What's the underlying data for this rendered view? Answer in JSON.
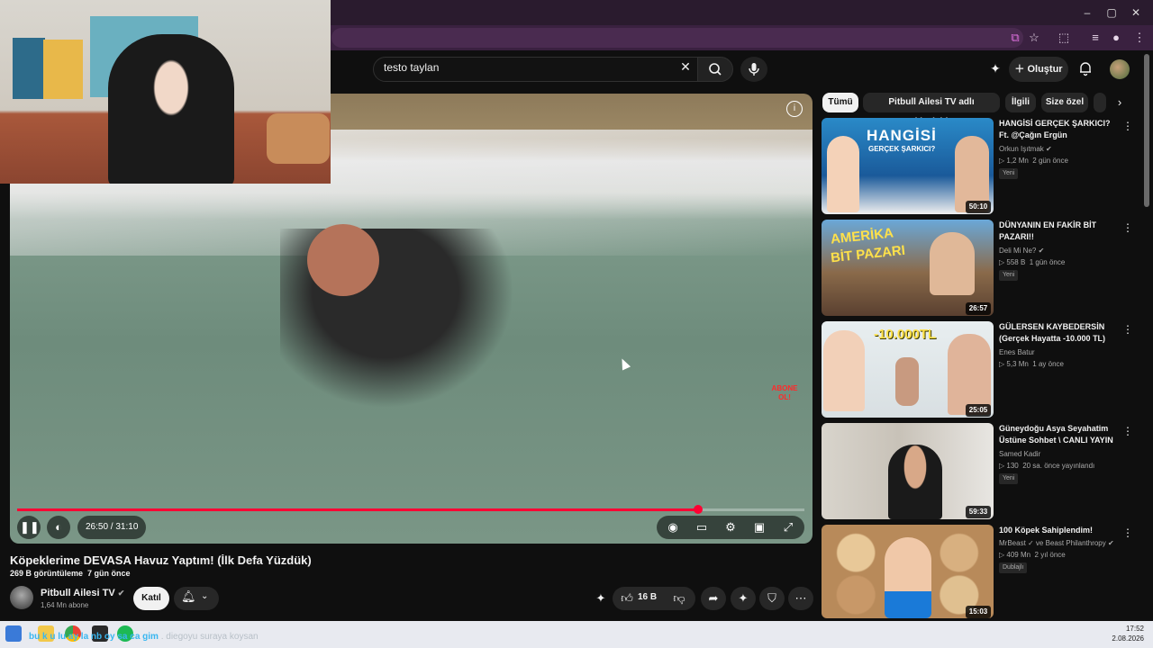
{
  "window": {
    "controls": [
      "–",
      "▢",
      "✕"
    ]
  },
  "search": {
    "query": "testo taylan"
  },
  "header": {
    "create_label": "Oluştur"
  },
  "player": {
    "current_time": "26:50",
    "duration": "31:10",
    "time_display": "26:50 / 31:10",
    "progress_fraction": 0.865,
    "watermark": "ABONE OL!"
  },
  "video": {
    "title": "Köpeklerime DEVASA Havuz Yaptım! (İlk Defa Yüzdük)",
    "views": "269 B görüntüleme",
    "age": "7 gün önce",
    "channel": "Pitbull Ailesi TV",
    "subscribers": "1,64 Mn abone",
    "join_label": "Katıl",
    "likes": "16 B"
  },
  "chips": [
    {
      "label": "Tümü",
      "active": true
    },
    {
      "label": "Pitbull Ailesi TV adlı yükleyiciden",
      "active": false
    },
    {
      "label": "İlgili",
      "active": false
    },
    {
      "label": "Size özel",
      "active": false
    }
  ],
  "recommendations": [
    {
      "title": "HANGİSİ GERÇEK ŞARKICI? Ft. @Çağın Ergün",
      "channel": "Orkun Işıtmak",
      "verified": true,
      "views": "1,2 Mn",
      "age": "2 gün önce",
      "badge": "Yeni",
      "duration": "50:10",
      "thumb_text": "HANGİSİ",
      "thumb_sub": "GERÇEK ŞARKICI?"
    },
    {
      "title": "DÜNYANIN EN FAKİR BİT PAZARI!!",
      "channel": "Deli Mi Ne?",
      "verified": true,
      "views": "558 B",
      "age": "1 gün önce",
      "badge": "Yeni",
      "duration": "26:57",
      "thumb_text": "AMERİKA",
      "thumb_sub": "BİT PAZARI"
    },
    {
      "title": "GÜLERSEN KAYBEDERSİN (Gerçek Hayatta -10.000 TL)",
      "channel": "Enes Batur",
      "verified": false,
      "views": "5,3 Mn",
      "age": "1 ay önce",
      "badge": "",
      "duration": "25:05",
      "thumb_text": "-10.000TL",
      "thumb_sub": ""
    },
    {
      "title": "Güneydoğu Asya Seyahatim Üstüne Sohbet \\ CANLI YAYIN",
      "channel": "Samed Kadir",
      "verified": false,
      "views": "130",
      "age": "20 sa. önce yayınlandı",
      "badge": "Yeni",
      "duration": "59:33",
      "thumb_text": "",
      "thumb_sub": ""
    },
    {
      "title": "100 Köpek Sahiplendim!",
      "channel": "MrBeast ✓ ve Beast Philanthropy",
      "verified": true,
      "views": "409 Mn",
      "age": "2 yıl önce",
      "badge": "Dublajlı",
      "duration": "15:03",
      "thumb_text": "",
      "thumb_sub": ""
    }
  ],
  "taskbar": {
    "ticker_primary": "bu k u lu ay la nb oy sa ca gim",
    "ticker_secondary": ". diegoyu suraya koysan",
    "time": "17:52",
    "date": "2.08.2026"
  },
  "colors": {
    "accent": "#ff0033",
    "background": "#0f0f0f",
    "chip_active": "#f1f1f1",
    "tab_bar": "#2a1b2e"
  }
}
